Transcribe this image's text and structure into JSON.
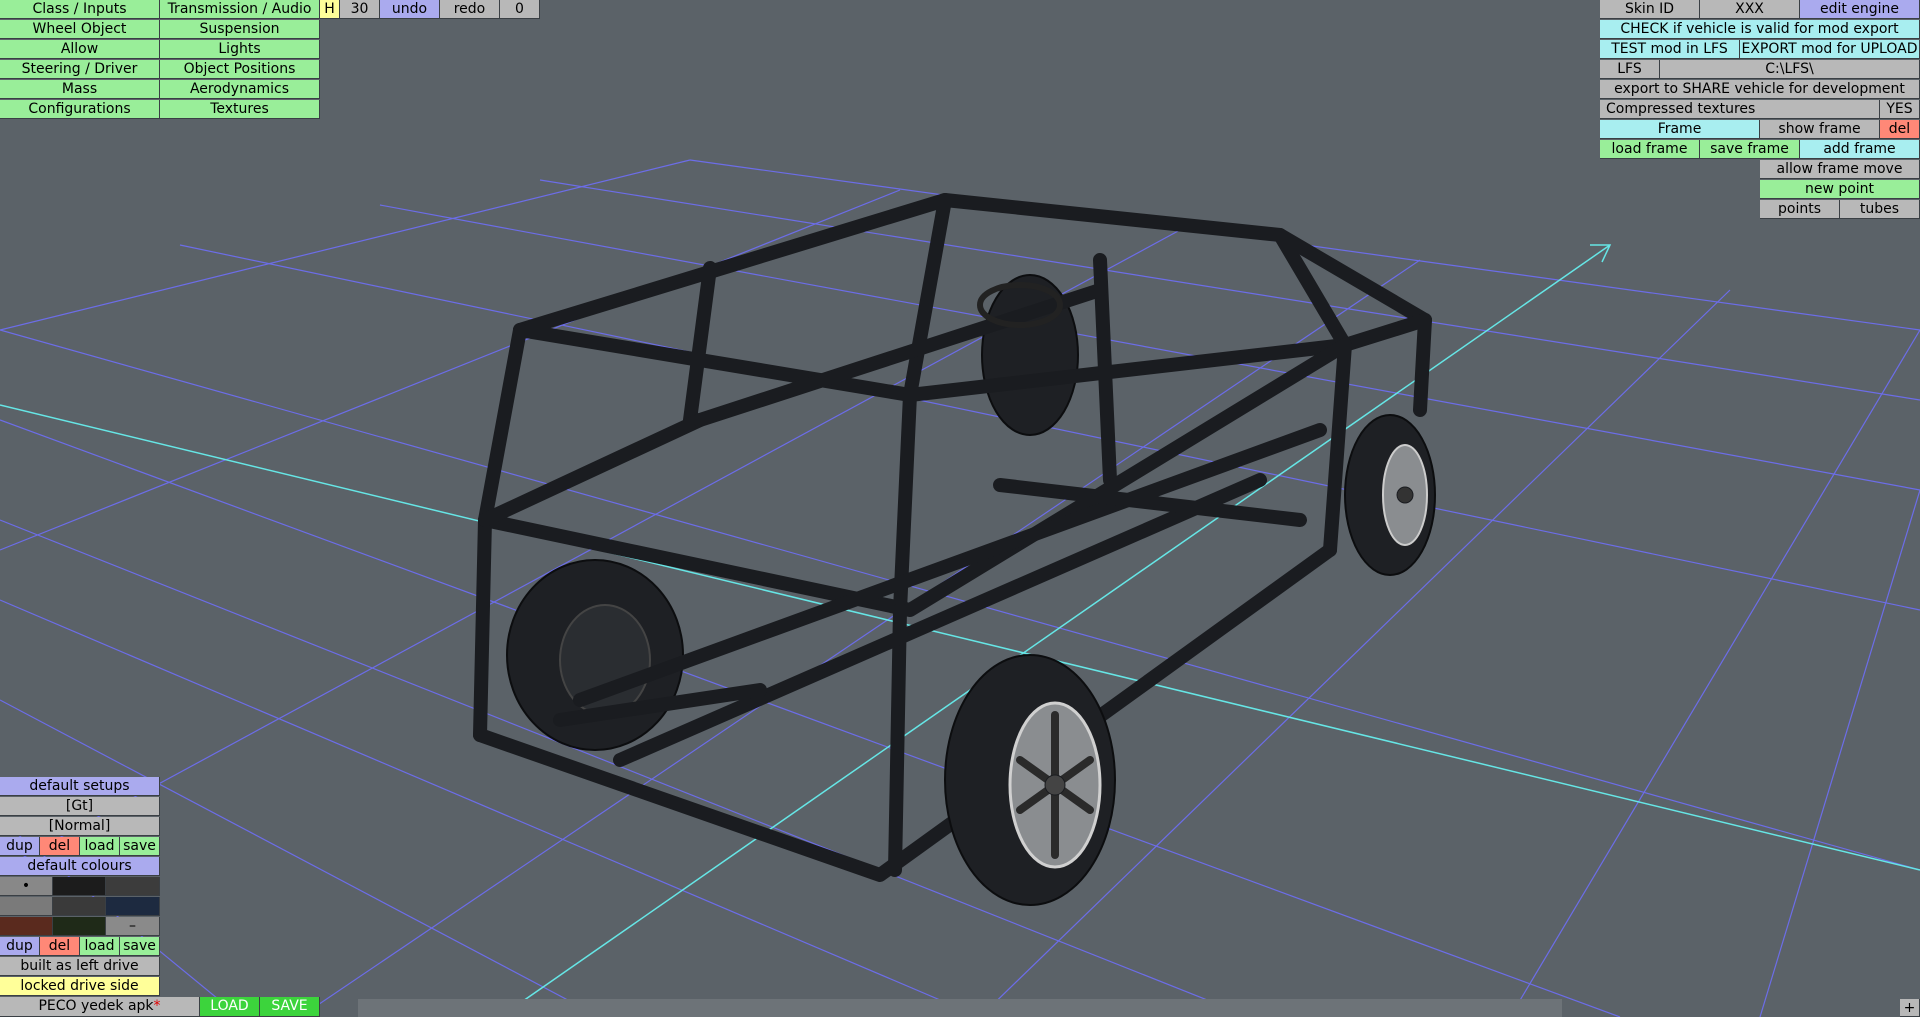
{
  "top_menu": {
    "class_inputs": "Class / Inputs",
    "transmission_audio": "Transmission / Audio",
    "wheel_object": "Wheel Object",
    "suspension": "Suspension",
    "allow": "Allow",
    "lights": "Lights",
    "steering_driver": "Steering / Driver",
    "object_positions": "Object Positions",
    "mass": "Mass",
    "aerodynamics": "Aerodynamics",
    "configurations": "Configurations",
    "textures": "Textures",
    "h_label": "H",
    "h_value": "30",
    "undo": "undo",
    "redo": "redo",
    "counter": "0"
  },
  "right_panel": {
    "skin_id": "Skin ID",
    "xxx": "XXX",
    "edit_engine": "edit engine",
    "check_valid": "CHECK if vehicle is valid for mod export",
    "test_mod": "TEST mod in LFS",
    "export_mod": "EXPORT mod for UPLOAD",
    "lfs": "LFS",
    "lfs_path": "C:\\LFS\\",
    "export_share": "export to SHARE vehicle for development",
    "compressed_textures": "Compressed textures",
    "compressed_value": "YES",
    "frame": "Frame",
    "show_frame": "show frame",
    "del": "del",
    "load_frame": "load frame",
    "save_frame": "save frame",
    "add_frame": "add frame",
    "allow_frame_move": "allow frame move",
    "new_point": "new point",
    "points": "points",
    "tubes": "tubes"
  },
  "bottom_left": {
    "default_setups": "default setups",
    "gt": "[Gt]",
    "normal": "[Normal]",
    "dup": "dup",
    "del": "del",
    "load": "load",
    "save": "save",
    "default_colours": "default colours",
    "dot": "•",
    "dash": "–",
    "built_as": "built as left drive",
    "locked_drive": "locked drive side",
    "filename": "PECO yedek apk",
    "modified_mark": "*",
    "load_caps": "LOAD",
    "save_caps": "SAVE",
    "colour_swatches": [
      "#888888",
      "#1c1c1c",
      "#3c3c3c",
      "#7a7a7a",
      "#3a3a3a",
      "#1d2a40",
      "#5a2a1e",
      "#1f2a18",
      "#8a8a8a"
    ]
  },
  "corner": {
    "plus": "+"
  },
  "colors": {
    "green": "#99ee99",
    "blue": "#aaaaee",
    "cyan": "#a8eef0",
    "grey": "#b8b8b8",
    "yellow": "#ffff99",
    "red": "#ff8877",
    "scene_bg": "#5b6268",
    "grid": "#6f6fff",
    "axis": "#66e6e6",
    "frame_tube": "#1a1c20"
  }
}
